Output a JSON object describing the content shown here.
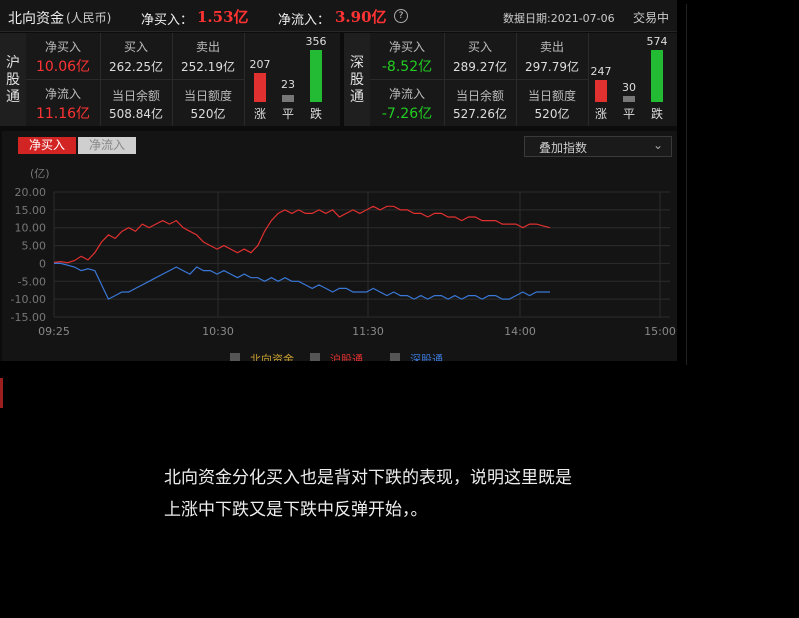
{
  "header": {
    "title": "北向资金",
    "currency": "(人民币)",
    "net_buy_label": "净买入：",
    "net_buy_value": "1.53亿",
    "net_inflow_label": "净流入：",
    "net_inflow_value": "3.90亿",
    "help_icon": "question-circle-icon",
    "date_label": "数据日期:2021-07-06",
    "status": "交易中"
  },
  "shanghai": {
    "name_chars": [
      "沪",
      "股",
      "通"
    ],
    "net_buy_label": "净买入",
    "net_buy_value": "10.06亿",
    "net_inflow_label": "净流入",
    "net_inflow_value": "11.16亿",
    "buy_label": "买入",
    "buy_value": "262.25亿",
    "sell_label": "卖出",
    "sell_value": "252.19亿",
    "balance_label": "当日余额",
    "balance_value": "508.84亿",
    "quota_label": "当日额度",
    "quota_value": "520亿",
    "up_count": "207",
    "flat_count": "23",
    "down_count": "356",
    "up_label": "涨",
    "flat_label": "平",
    "down_label": "跌"
  },
  "shenzhen": {
    "name_chars": [
      "深",
      "股",
      "通"
    ],
    "net_buy_label": "净买入",
    "net_buy_value": "-8.52亿",
    "net_inflow_label": "净流入",
    "net_inflow_value": "-7.26亿",
    "buy_label": "买入",
    "buy_value": "289.27亿",
    "sell_label": "卖出",
    "sell_value": "297.79亿",
    "balance_label": "当日余额",
    "balance_value": "527.26亿",
    "quota_label": "当日额度",
    "quota_value": "520亿",
    "up_count": "247",
    "flat_count": "30",
    "down_count": "574",
    "up_label": "涨",
    "flat_label": "平",
    "down_label": "跌"
  },
  "tabs": {
    "net_buy": "净买入",
    "net_inflow": "净流入"
  },
  "overlay_select": {
    "label": "叠加指数"
  },
  "chart_data": {
    "type": "line",
    "unit_label": "(亿)",
    "y_ticks": [
      "20.00",
      "15.00",
      "10.00",
      "5.00",
      "0",
      "-5.00",
      "-10.00",
      "-15.00"
    ],
    "ylim": [
      -15,
      20
    ],
    "x_ticks": [
      "09:25",
      "10:30",
      "11:30",
      "14:00",
      "15:00"
    ],
    "series": [
      {
        "name": "沪股通",
        "color": "#e03030",
        "values": [
          0.3,
          0.5,
          0.2,
          0.8,
          2,
          1,
          3,
          6,
          8,
          7,
          9,
          10,
          9,
          11,
          10,
          11,
          12,
          11,
          12,
          10,
          9,
          8,
          6,
          5,
          4,
          5,
          4,
          3,
          4,
          3,
          5,
          9,
          12,
          14,
          15,
          14,
          15,
          14,
          14,
          15,
          14,
          15,
          13,
          14,
          15,
          14,
          15,
          16,
          15,
          16,
          16,
          15,
          15,
          14,
          14,
          13,
          14,
          14,
          13,
          13,
          12,
          13,
          13,
          12,
          12,
          12,
          11,
          11,
          11,
          10,
          11,
          11,
          10.5,
          10
        ]
      },
      {
        "name": "深股通",
        "color": "#3a78d8",
        "values": [
          0,
          0,
          -0.5,
          -1,
          -2,
          -1.5,
          -2,
          -6,
          -10,
          -9,
          -8,
          -8,
          -7,
          -6,
          -5,
          -4,
          -3,
          -2,
          -1,
          -2,
          -3,
          -1,
          -2,
          -2,
          -3,
          -2,
          -3,
          -4,
          -3,
          -4,
          -4,
          -5,
          -4,
          -5,
          -4,
          -5,
          -5,
          -6,
          -7,
          -6,
          -7,
          -8,
          -7,
          -7,
          -8,
          -8,
          -8,
          -7,
          -8,
          -9,
          -8,
          -9,
          -9,
          -10,
          -9,
          -10,
          -9,
          -9,
          -10,
          -9,
          -10,
          -9,
          -9,
          -10,
          -9,
          -9,
          -10,
          -10,
          -9,
          -8,
          -9,
          -8,
          -8,
          -8
        ]
      }
    ],
    "legend": [
      {
        "label": "北向资金",
        "color": "#c8a030"
      },
      {
        "label": "沪股通",
        "color": "#e03030"
      },
      {
        "label": "深股通",
        "color": "#3a78d8"
      }
    ],
    "grid": true
  },
  "article": {
    "line1": "北向资金分化买入也是背对下跌的表现，说明这里既是",
    "line2": "上涨中下跌又是下跌中反弹开始，。"
  }
}
